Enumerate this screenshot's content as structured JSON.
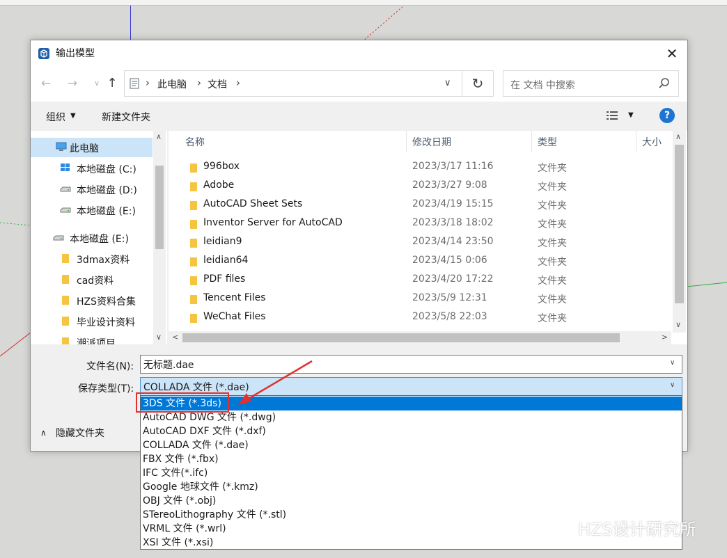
{
  "dialog": {
    "title": "输出模型",
    "close_glyph": "✕"
  },
  "navbar": {
    "breadcrumbs": [
      "此电脑",
      "文档"
    ],
    "search_placeholder": "在 文档 中搜索"
  },
  "toolbar": {
    "organize": "组织",
    "new_folder": "新建文件夹",
    "help": "?"
  },
  "nav_pane": {
    "items": [
      {
        "label": "此电脑",
        "icon": "computer-icon",
        "selected": true
      },
      {
        "label": "本地磁盘 (C:)",
        "icon": "windows-drive-icon"
      },
      {
        "label": "本地磁盘 (D:)",
        "icon": "drive-icon"
      },
      {
        "label": "本地磁盘 (E:)",
        "icon": "drive-icon"
      },
      {
        "label": "本地磁盘 (E:)",
        "icon": "drive-icon"
      },
      {
        "label": "3dmax资料",
        "icon": "folder-icon"
      },
      {
        "label": "cad资料",
        "icon": "folder-icon"
      },
      {
        "label": "HZS资料合集",
        "icon": "folder-icon"
      },
      {
        "label": "毕业设计资料",
        "icon": "folder-icon"
      },
      {
        "label": "潮派项目",
        "icon": "folder-icon"
      }
    ]
  },
  "file_list": {
    "headers": [
      "名称",
      "修改日期",
      "类型",
      "大小"
    ],
    "rows": [
      {
        "name": "996box",
        "date": "2023/3/17 11:16",
        "type": "文件夹"
      },
      {
        "name": "Adobe",
        "date": "2023/3/27 9:08",
        "type": "文件夹"
      },
      {
        "name": "AutoCAD Sheet Sets",
        "date": "2023/4/19 15:15",
        "type": "文件夹"
      },
      {
        "name": "Inventor Server for AutoCAD",
        "date": "2023/3/18 18:02",
        "type": "文件夹"
      },
      {
        "name": "leidian9",
        "date": "2023/4/14 23:50",
        "type": "文件夹"
      },
      {
        "name": "leidian64",
        "date": "2023/4/15 0:06",
        "type": "文件夹"
      },
      {
        "name": "PDF files",
        "date": "2023/4/20 17:22",
        "type": "文件夹"
      },
      {
        "name": "Tencent Files",
        "date": "2023/5/9 12:31",
        "type": "文件夹"
      },
      {
        "name": "WeChat Files",
        "date": "2023/5/8 22:03",
        "type": "文件夹"
      }
    ]
  },
  "form": {
    "filename_label": "文件名(N):",
    "filename_value": "无标题.dae",
    "savetype_label": "保存类型(T):",
    "savetype_value": "COLLADA 文件 (*.dae)",
    "hide_folders": "隐藏文件夹"
  },
  "dropdown": {
    "options": [
      {
        "label": "3DS 文件 (*.3ds)",
        "selected": true
      },
      {
        "label": "AutoCAD DWG 文件 (*.dwg)"
      },
      {
        "label": "AutoCAD DXF 文件 (*.dxf)"
      },
      {
        "label": "COLLADA 文件 (*.dae)"
      },
      {
        "label": "FBX 文件 (*.fbx)"
      },
      {
        "label": "IFC 文件(*.ifc)"
      },
      {
        "label": "Google 地球文件 (*.kmz)"
      },
      {
        "label": "OBJ 文件 (*.obj)"
      },
      {
        "label": "STereoLithography 文件 (*.stl)"
      },
      {
        "label": "VRML 文件 (*.wrl)"
      },
      {
        "label": "XSI 文件 (*.xsi)"
      }
    ]
  },
  "watermark": {
    "text": "HZS设计研究所"
  },
  "colors": {
    "accent": "#0078d7",
    "annotation_red": "#e03030",
    "selection_bg": "#cce4f7",
    "folder": "#f5c542"
  }
}
